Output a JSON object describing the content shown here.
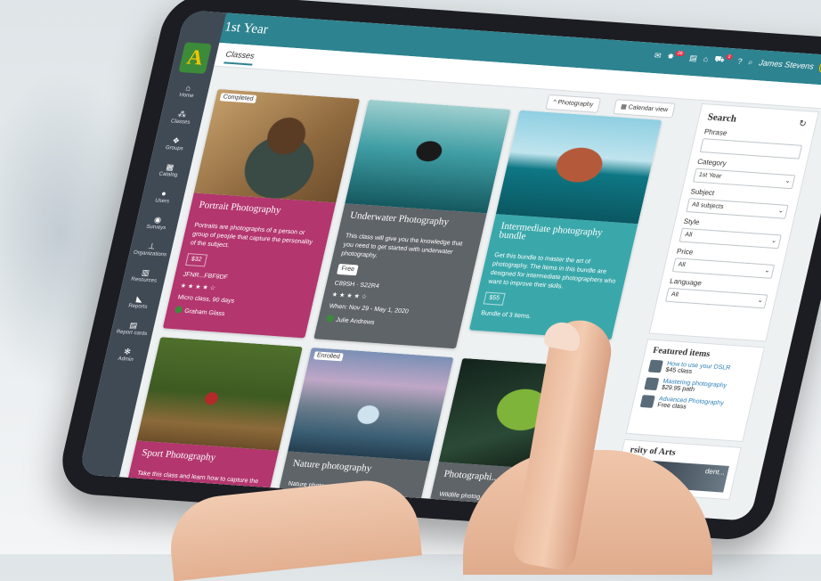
{
  "app": {
    "title": "1st Year",
    "logo": "A"
  },
  "nav": [
    {
      "label": "Home",
      "icon": "home-icon",
      "glyph": "⌂"
    },
    {
      "label": "Classes",
      "icon": "classes-icon",
      "glyph": "⁂"
    },
    {
      "label": "Groups",
      "icon": "groups-icon",
      "glyph": "❖"
    },
    {
      "label": "Catalog",
      "icon": "catalog-icon",
      "glyph": "▦"
    },
    {
      "label": "Users",
      "icon": "users-icon",
      "glyph": "●"
    },
    {
      "label": "Surveys",
      "icon": "surveys-icon",
      "glyph": "◉"
    },
    {
      "label": "Organizations",
      "icon": "organizations-icon",
      "glyph": "⊥"
    },
    {
      "label": "Resources",
      "icon": "resources-icon",
      "glyph": "▥"
    },
    {
      "label": "Reports",
      "icon": "reports-icon",
      "glyph": "◣"
    },
    {
      "label": "Report cards",
      "icon": "report-cards-icon",
      "glyph": "▤"
    },
    {
      "label": "Admin",
      "icon": "admin-icon",
      "glyph": "✻"
    }
  ],
  "header": {
    "tab": "Classes",
    "user": "James Stevens",
    "badges": {
      "notifications": "28",
      "cart": "2"
    },
    "icons": {
      "mail": "✉",
      "bell": "✸",
      "list": "▤",
      "bank": "⌂",
      "cart": "⛟",
      "help": "?",
      "search": "⌕",
      "chevron": "⌄"
    }
  },
  "toolbar": {
    "photography": "^ Photography",
    "calendar": "▦ Calendar view"
  },
  "cards": [
    {
      "tag": "Completed",
      "title": "Portrait Photography",
      "description": "Portraits are photographs of a person or group of people that capture the personality of the subject.",
      "price": "$32",
      "code": "JFNR...FBF9DF",
      "stars": "★★★★☆",
      "meta": "Micro class, 90 days",
      "instructor": "Graham Glass"
    },
    {
      "tag": "",
      "title": "Underwater Photography",
      "description": "This class will give you the knowledge that you need to get started with underwater photography.",
      "price": "Free",
      "code": "C89SH · S22R4",
      "stars": "★★★★☆",
      "meta": "When: Nov 29 - May 1, 2020",
      "instructor": "Julie Andrews"
    },
    {
      "tag": "",
      "title": "Intermediate photography bundle",
      "description": "Get this bundle to master the art of photography. The items in this bundle are designed for intermediate photographers who want to improve their skills.",
      "price": "$55",
      "meta": "Bundle of 3 items."
    },
    {
      "tag": "",
      "title": "Sport Photography",
      "description": "Take this class and learn how to capture the excitement of sports. Your photos can have the power to influence viewers to e..."
    },
    {
      "tag": "Enrolled",
      "title": "Nature photography",
      "description": "Nature photography is a range of phot..."
    },
    {
      "tag": "",
      "title": "Photographi...",
      "description": "Wildlife photog... documenting ... natural habitat..."
    }
  ],
  "search": {
    "title": "Search",
    "refresh_icon": "↻",
    "phrase_label": "Phrase",
    "phrase_value": "",
    "category_label": "Category",
    "category_value": "1st Year",
    "subject_label": "Subject",
    "subject_value": "All subjects",
    "style_label": "Style",
    "style_value": "All",
    "price_label": "Price",
    "price_value": "All",
    "language_label": "Language",
    "language_value": "All"
  },
  "featured": {
    "title": "Featured items",
    "items": [
      {
        "name": "How to use your DSLR",
        "price": "$45 class"
      },
      {
        "name": "Mastering photography",
        "price": "$29.95 path"
      },
      {
        "name": "Advanced Photography",
        "price": "Free class"
      }
    ]
  },
  "university": {
    "title": "rsity of Arts",
    "image_text": "dent..."
  }
}
